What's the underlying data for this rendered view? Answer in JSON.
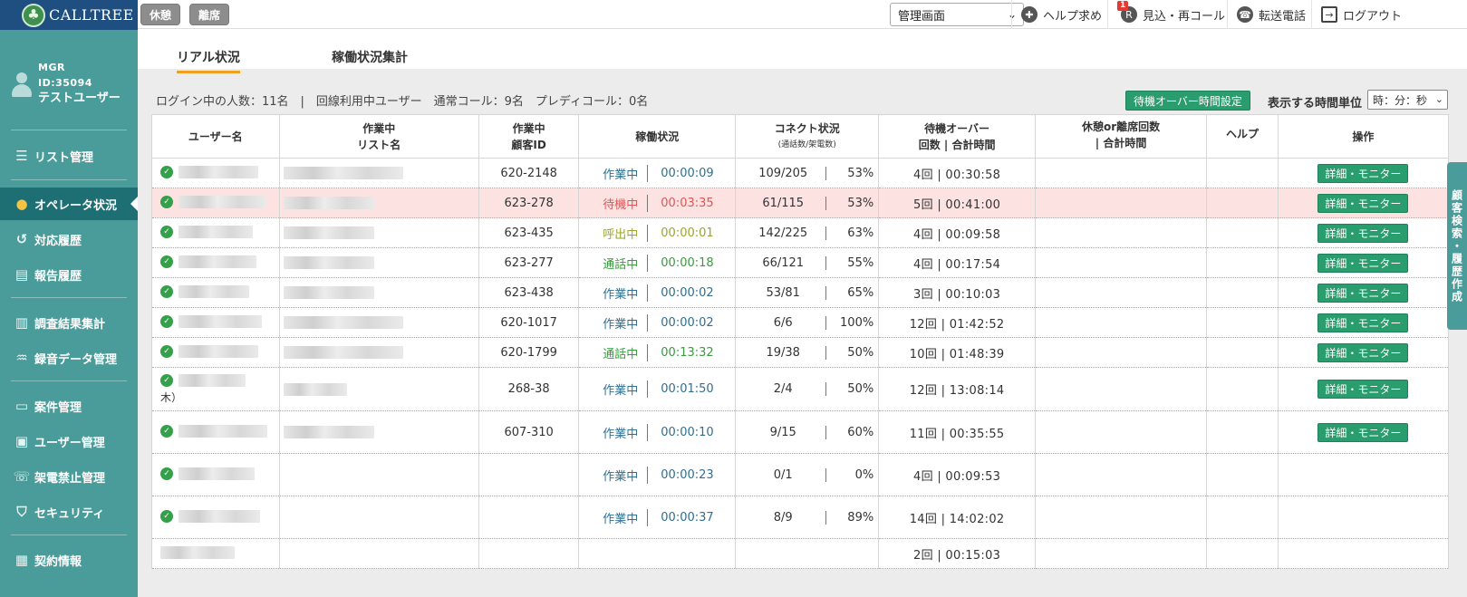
{
  "brand": {
    "logo_text": "CALLTREE"
  },
  "user": {
    "role": "MGR",
    "id": "ID:35094",
    "name": "テストユーザー"
  },
  "sidebar": {
    "items": [
      {
        "label": "リスト管理",
        "icon": "list-icon"
      },
      {
        "label": "オペレータ状況",
        "icon": "operators-icon",
        "active": true
      },
      {
        "label": "対応履歴",
        "icon": "history-icon"
      },
      {
        "label": "報告履歴",
        "icon": "report-icon"
      },
      {
        "label": "調査結果集計",
        "icon": "clipboard-icon"
      },
      {
        "label": "録音データ管理",
        "icon": "audio-wave-icon"
      },
      {
        "label": "案件管理",
        "icon": "folder-icon"
      },
      {
        "label": "ユーザー管理",
        "icon": "id-card-icon"
      },
      {
        "label": "架電禁止管理",
        "icon": "phone-block-icon"
      },
      {
        "label": "セキュリティ",
        "icon": "shield-icon"
      },
      {
        "label": "契約情報",
        "icon": "contract-icon"
      }
    ]
  },
  "topbar": {
    "break_label": "休憩",
    "away_label": "離席",
    "mode_select_value": "管理画面",
    "help_label": "ヘルプ求め",
    "callback_label": "見込・再コール",
    "callback_badge": "1",
    "transfer_label": "転送電話",
    "logout_label": "ログアウト"
  },
  "tabs": [
    {
      "label": "リアル状況",
      "active": true
    },
    {
      "label": "稼働状況集計",
      "active": false
    }
  ],
  "summary": "ログイン中の人数：11名　|　回線利用中ユーザー　通常コール：9名　プレディコール：0名",
  "over_time_button": "待機オーバー時間設定",
  "time_unit": {
    "label": "表示する時間単位",
    "value": "時：分：秒"
  },
  "side_tab_label": "顧客検索・履歴作成",
  "table": {
    "headers": {
      "user": "ユーザー名",
      "list": "作業中\nリスト名",
      "customer": "作業中\n顧客ID",
      "status": "稼働状況",
      "connect": "コネクト状況",
      "connect_sub": "(通話数/架電数)",
      "wait_over": "待機オーバー\n回数 | 合計時間",
      "break": "休憩or離席回数\n| 合計時間",
      "help": "ヘルプ",
      "action": "操作"
    },
    "action_label": "詳細・モニター",
    "rows": [
      {
        "online": true,
        "name_tail": "",
        "customer_id": "620-2148",
        "status": "作業中",
        "status_kind": "work",
        "time": "00:00:09",
        "conn": "109/205",
        "rate": "53%",
        "wait": "4回 | 00:30:58",
        "has_action": true,
        "list": true,
        "highlight": false
      },
      {
        "online": true,
        "name_tail": "",
        "customer_id": "623-278",
        "status": "待機中",
        "status_kind": "wait",
        "time": "00:03:35",
        "conn": "61/115",
        "rate": "53%",
        "wait": "5回 | 00:41:00",
        "has_action": true,
        "list": true,
        "highlight": true
      },
      {
        "online": true,
        "name_tail": "",
        "customer_id": "623-435",
        "status": "呼出中",
        "status_kind": "dial",
        "time": "00:00:01",
        "conn": "142/225",
        "rate": "63%",
        "wait": "4回 | 00:09:58",
        "has_action": true,
        "list": true,
        "highlight": false
      },
      {
        "online": true,
        "name_tail": "",
        "customer_id": "623-277",
        "status": "通話中",
        "status_kind": "talk",
        "time": "00:00:18",
        "conn": "66/121",
        "rate": "55%",
        "wait": "4回 | 00:17:54",
        "has_action": true,
        "list": true,
        "highlight": false
      },
      {
        "online": true,
        "name_tail": "",
        "customer_id": "623-438",
        "status": "作業中",
        "status_kind": "work",
        "time": "00:00:02",
        "conn": "53/81",
        "rate": "65%",
        "wait": "3回 | 00:10:03",
        "has_action": true,
        "list": true,
        "highlight": false
      },
      {
        "online": true,
        "name_tail": "",
        "customer_id": "620-1017",
        "status": "作業中",
        "status_kind": "work",
        "time": "00:00:02",
        "conn": "6/6",
        "rate": "100%",
        "wait": "12回 | 01:42:52",
        "has_action": true,
        "list": true,
        "highlight": false
      },
      {
        "online": true,
        "name_tail": "",
        "customer_id": "620-1799",
        "status": "通話中",
        "status_kind": "talk",
        "time": "00:13:32",
        "conn": "19/38",
        "rate": "50%",
        "wait": "10回 | 01:48:39",
        "has_action": true,
        "list": true,
        "highlight": false
      },
      {
        "online": true,
        "name_tail": "木）",
        "customer_id": "268-38",
        "status": "作業中",
        "status_kind": "work",
        "time": "00:01:50",
        "conn": "2/4",
        "rate": "50%",
        "wait": "12回 | 13:08:14",
        "has_action": true,
        "list": true,
        "highlight": false
      },
      {
        "online": true,
        "name_tail": "",
        "customer_id": "607-310",
        "status": "作業中",
        "status_kind": "work",
        "time": "00:00:10",
        "conn": "9/15",
        "rate": "60%",
        "wait": "11回 | 00:35:55",
        "has_action": true,
        "list": true,
        "highlight": false
      },
      {
        "online": true,
        "name_tail": "",
        "customer_id": "",
        "status": "作業中",
        "status_kind": "work",
        "time": "00:00:23",
        "conn": "0/1",
        "rate": "0%",
        "wait": "4回 | 00:09:53",
        "has_action": false,
        "list": false,
        "highlight": false
      },
      {
        "online": true,
        "name_tail": "",
        "customer_id": "",
        "status": "作業中",
        "status_kind": "work",
        "time": "00:00:37",
        "conn": "8/9",
        "rate": "89%",
        "wait": "14回 | 14:02:02",
        "has_action": false,
        "list": false,
        "highlight": false
      },
      {
        "online": false,
        "name_tail": "",
        "customer_id": "",
        "status": "",
        "status_kind": "",
        "time": "",
        "conn": "",
        "rate": "",
        "wait": "2回 | 00:15:03",
        "has_action": false,
        "list": false,
        "highlight": false
      }
    ]
  },
  "colors": {
    "sidebar": "#4a9c9a",
    "active_nav": "#1e6f73",
    "logo_bg": "#1f4f80",
    "action_green": "#2a9d6e",
    "highlight_row": "#fde2e2",
    "tab_underline": "#f0a020"
  }
}
